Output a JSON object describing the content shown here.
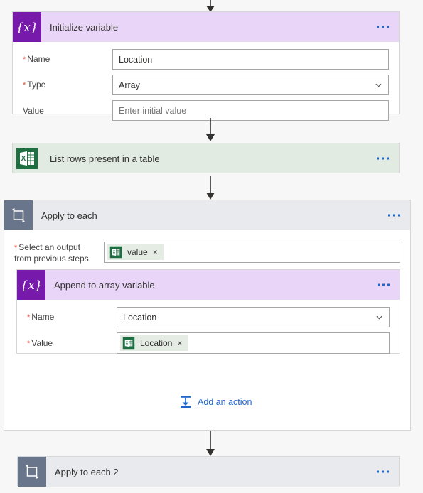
{
  "flow": {
    "steps": [
      {
        "id": "initialize-variable",
        "title": "Initialize variable",
        "icon": "variable-braces-icon",
        "icon_glyph": "{x}",
        "header_color": "#e9d5f7",
        "icon_color": "#7719aa",
        "fields": [
          {
            "label": "Name",
            "required": true,
            "value": "Location",
            "is_placeholder": false,
            "control": "text"
          },
          {
            "label": "Type",
            "required": true,
            "value": "Array",
            "is_placeholder": false,
            "control": "dropdown"
          },
          {
            "label": "Value",
            "required": false,
            "value": "Enter initial value",
            "is_placeholder": true,
            "control": "text"
          }
        ]
      },
      {
        "id": "list-rows-present-in-a-table",
        "title": "List rows present in a table",
        "icon": "excel-icon",
        "header_color": "#e2ebe2",
        "icon_color": "#1d6f42"
      },
      {
        "id": "apply-to-each",
        "title": "Apply to each",
        "icon": "loop-icon",
        "header_color": "#e8eaee",
        "icon_color": "#69758a",
        "output_field": {
          "label_line1": "Select an output",
          "label_line2": "from previous steps",
          "required": true,
          "token": {
            "text": "value",
            "icon": "excel-icon",
            "remove": "×"
          }
        },
        "child": {
          "id": "append-to-array-variable",
          "title": "Append to array variable",
          "icon": "variable-braces-icon",
          "icon_glyph": "{x}",
          "header_color": "#e9d5f7",
          "icon_color": "#7719aa",
          "fields": [
            {
              "label": "Name",
              "required": true,
              "value": "Location",
              "is_placeholder": false,
              "control": "dropdown"
            },
            {
              "label": "Value",
              "required": true,
              "control": "token",
              "token": {
                "text": "Location",
                "icon": "excel-icon",
                "remove": "×"
              }
            }
          ]
        },
        "add_action": {
          "label": "Add an action",
          "icon": "add-action-icon"
        }
      },
      {
        "id": "apply-to-each-2",
        "title": "Apply to each 2",
        "icon": "loop-icon",
        "header_color": "#e8eaee",
        "icon_color": "#69758a"
      }
    ]
  },
  "colors": {
    "accent_blue": "#2266cc",
    "purple": "#7719aa",
    "excel_green": "#1d6f42",
    "loop_slate": "#69758a",
    "required_red": "#e74c3c",
    "page_bg": "#f7f7f7"
  }
}
